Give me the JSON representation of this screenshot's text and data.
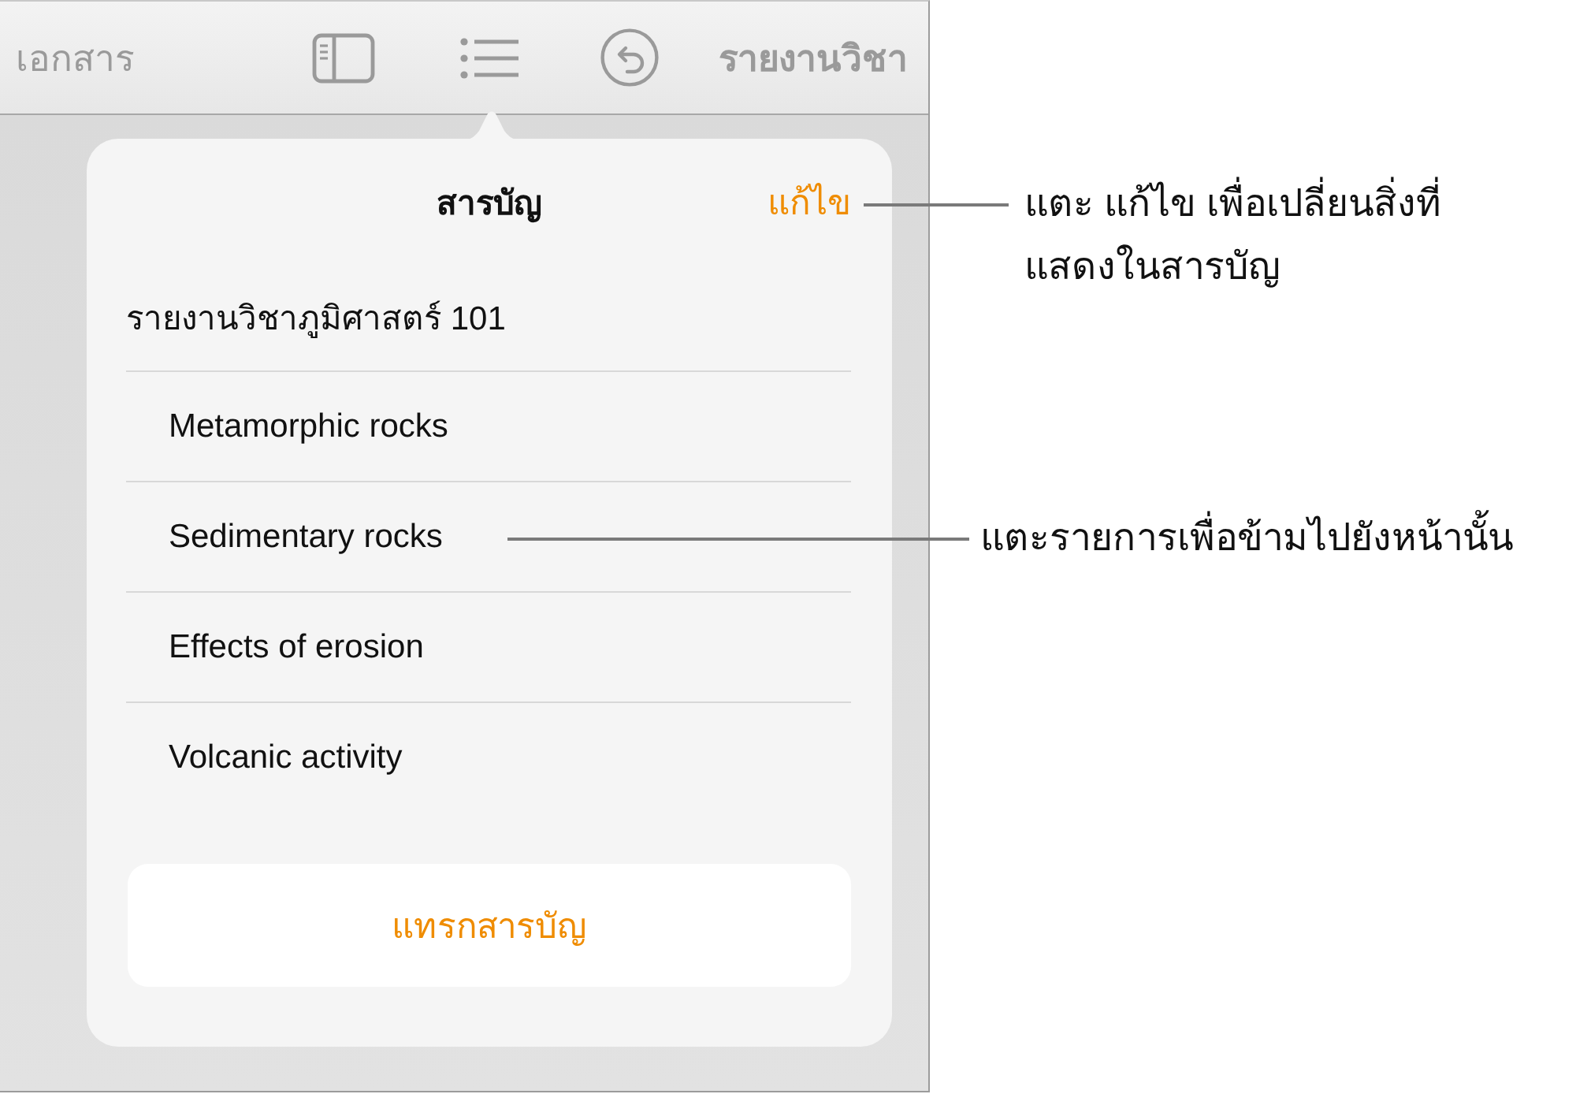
{
  "toolbar": {
    "back_label": "เอกสาร",
    "document_title": "รายงานวิชา"
  },
  "popover": {
    "title": "สารบัญ",
    "edit_button": "แก้ไข",
    "entries": [
      {
        "label": "รายงานวิชาภูมิศาสตร์ 101",
        "children": [
          {
            "label": "Metamorphic rocks"
          },
          {
            "label": "Sedimentary rocks"
          },
          {
            "label": "Effects of erosion"
          },
          {
            "label": "Volcanic activity"
          }
        ]
      }
    ],
    "insert_button": "แทรกสารบัญ"
  },
  "callouts": [
    {
      "lines": [
        "แตะ แก้ไข เพื่อเปลี่ยนสิ่งที่",
        "แสดงในสารบัญ"
      ]
    },
    {
      "lines": [
        "แตะรายการเพื่อข้ามไปยังหน้านั้น"
      ]
    }
  ]
}
